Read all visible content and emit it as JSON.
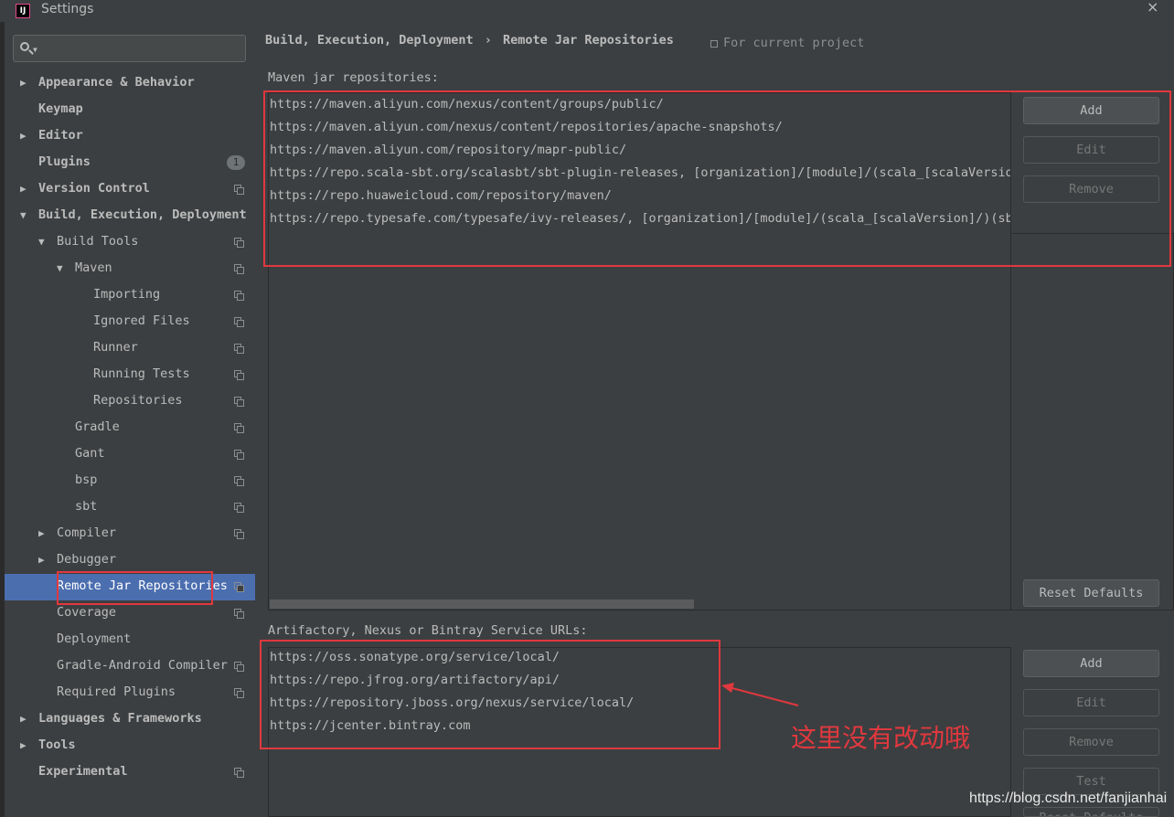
{
  "window": {
    "title": "Settings",
    "app_icon": "IJ"
  },
  "search": {
    "placeholder": ""
  },
  "sidebar": {
    "items": [
      {
        "label": "Appearance & Behavior",
        "arrow": "▶"
      },
      {
        "label": "Keymap"
      },
      {
        "label": "Editor",
        "arrow": "▶"
      },
      {
        "label": "Plugins",
        "badge": "1"
      },
      {
        "label": "Version Control",
        "arrow": "▶"
      },
      {
        "label": "Build, Execution, Deployment",
        "arrow": "▼"
      },
      {
        "label": "Build Tools",
        "arrow": "▼"
      },
      {
        "label": "Maven",
        "arrow": "▼"
      },
      {
        "label": "Importing"
      },
      {
        "label": "Ignored Files"
      },
      {
        "label": "Runner"
      },
      {
        "label": "Running Tests"
      },
      {
        "label": "Repositories"
      },
      {
        "label": "Gradle"
      },
      {
        "label": "Gant"
      },
      {
        "label": "bsp"
      },
      {
        "label": "sbt"
      },
      {
        "label": "Compiler",
        "arrow": "▶"
      },
      {
        "label": "Debugger",
        "arrow": "▶"
      },
      {
        "label": "Remote Jar Repositories",
        "selected": true
      },
      {
        "label": "Coverage"
      },
      {
        "label": "Deployment"
      },
      {
        "label": "Gradle-Android Compiler"
      },
      {
        "label": "Required Plugins"
      },
      {
        "label": "Languages & Frameworks",
        "arrow": "▶"
      },
      {
        "label": "Tools",
        "arrow": "▶"
      },
      {
        "label": "Experimental"
      }
    ]
  },
  "header": {
    "breadcrumb_parent": "Build, Execution, Deployment",
    "breadcrumb_sep": "›",
    "breadcrumb_current": "Remote Jar Repositories",
    "scope": "For current project"
  },
  "maven": {
    "label": "Maven jar repositories:",
    "urls": [
      "https://maven.aliyun.com/nexus/content/groups/public/",
      "https://maven.aliyun.com/nexus/content/repositories/apache-snapshots/",
      "https://maven.aliyun.com/repository/mapr-public/",
      "https://repo.scala-sbt.org/scalasbt/sbt-plugin-releases, [organization]/[module]/(scala_[scalaVersion]/)(sbt_[sbtVersion]/)[revision]/[type]s/[artifact](-[classifier]).[ext]",
      "https://repo.huaweicloud.com/repository/maven/",
      "https://repo.typesafe.com/typesafe/ivy-releases/, [organization]/[module]/(scala_[scalaVersion]/)(sbt_[sbtVersion]/)[revision]/[type]s/[artifact](-[classifier]).[ext]"
    ],
    "buttons": {
      "add": "Add",
      "edit": "Edit",
      "remove": "Remove",
      "reset": "Reset Defaults"
    }
  },
  "services": {
    "label": "Artifactory, Nexus or Bintray Service URLs:",
    "urls": [
      "https://oss.sonatype.org/service/local/",
      "https://repo.jfrog.org/artifactory/api/",
      "https://repository.jboss.org/nexus/service/local/",
      "https://jcenter.bintray.com"
    ],
    "buttons": {
      "add": "Add",
      "edit": "Edit",
      "remove": "Remove",
      "test": "Test",
      "reset": "Reset Defaults"
    }
  },
  "annotation": "这里没有改动哦",
  "watermark": "https://blog.csdn.net/fanjianhai",
  "colors": {
    "selection": "#4b6eaf",
    "annotation_red": "#e0383e",
    "background": "#3c3f41"
  }
}
